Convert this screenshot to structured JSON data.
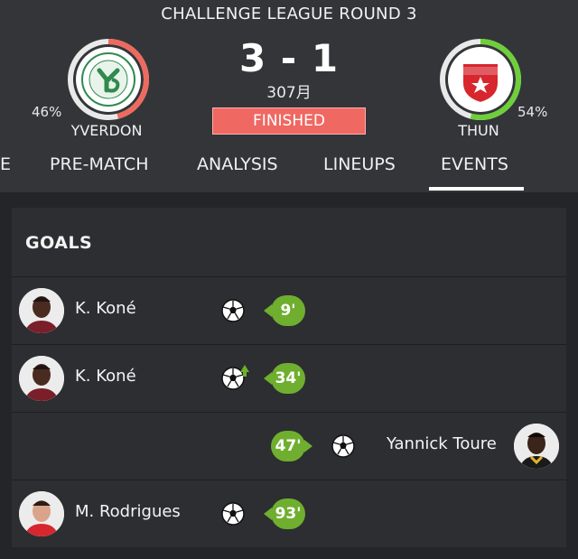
{
  "header": {
    "title": "CHALLENGE LEAGUE ROUND 3",
    "score": "3 - 1",
    "date": "307月",
    "status": "FINISHED"
  },
  "home": {
    "name": "YVERDON",
    "percent_label": "46%",
    "percent": 46,
    "logo_color": "#2f8a4f"
  },
  "away": {
    "name": "THUN",
    "percent_label": "54%",
    "percent": 54,
    "logo_color": "#d7262e"
  },
  "ring_colors": {
    "home": "#ee6a5f",
    "away": "#6fcf3a",
    "track": "#e9e9e9"
  },
  "tabs": [
    {
      "label": "E"
    },
    {
      "label": "PRE-MATCH"
    },
    {
      "label": "ANALYSIS"
    },
    {
      "label": "LINEUPS"
    },
    {
      "label": "EVENTS",
      "active": true
    }
  ],
  "events": {
    "section_title": "GOALS",
    "goals": [
      {
        "player": "K. Koné",
        "minute": "9'",
        "side": "home",
        "type": "goal"
      },
      {
        "player": "K. Koné",
        "minute": "34'",
        "side": "home",
        "type": "goal-extra"
      },
      {
        "player": "Yannick Toure",
        "minute": "47'",
        "side": "away",
        "type": "goal"
      },
      {
        "player": "M. Rodrigues",
        "minute": "93'",
        "side": "home",
        "type": "goal"
      }
    ]
  },
  "colors": {
    "accent_green": "#6fae2f",
    "status_red": "#ef6862"
  }
}
